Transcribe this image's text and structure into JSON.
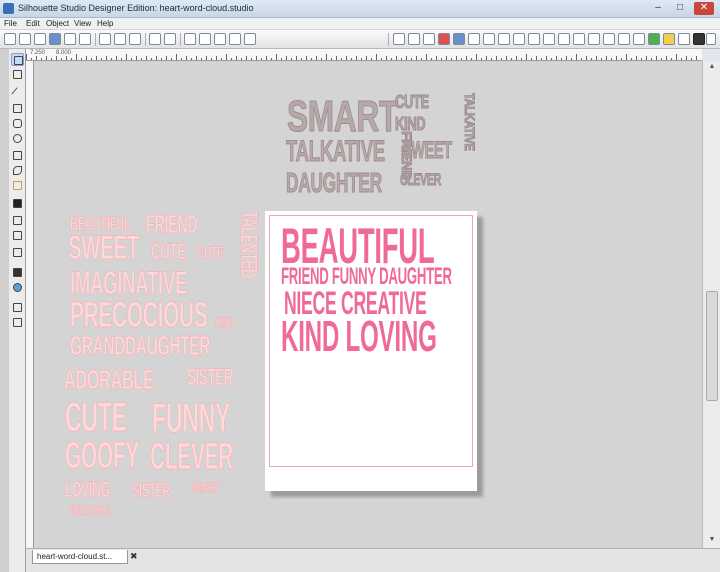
{
  "window": {
    "title": "Silhouette Studio Designer Edition: heart-word-cloud.studio",
    "minimize": "–",
    "maximize": "□",
    "close": "✕"
  },
  "menu": [
    "File",
    "Edit",
    "Object",
    "View",
    "Help"
  ],
  "ruler": {
    "labels": [
      "7.250",
      "8.000"
    ]
  },
  "colors": {
    "hot_pink": "#f06a98",
    "light_pink": "#ffd9d9",
    "grey_words": "#b8a8aa"
  },
  "grey_cloud": [
    "SMART",
    "CUTE",
    "KIND",
    "FRIEND",
    "TALKATIVE",
    "TALKATIVE",
    "SWEET",
    "DAUGHTER",
    "CLEVER"
  ],
  "pink_cloud": [
    "BEAUTIFUL",
    "FRIEND",
    "SWEET",
    "CUTE",
    "CUTE",
    "TALENTED",
    "IMAGINATIVE",
    "PRECOCIOUS",
    "KIND",
    "GRANDDAUGHTER",
    "ADORABLE",
    "SISTER",
    "CUTE",
    "FUNNY",
    "GOOFY",
    "CLEVER",
    "LOVING",
    "SISTER",
    "SMART",
    "BEAUTIFUL"
  ],
  "page_words": [
    "BEAUTIFUL",
    "FRIEND FUNNY DAUGHTER",
    "NIECE CREATIVE",
    "KIND LOVING"
  ],
  "tab": {
    "label": "heart-word-cloud.st...",
    "close": "✖"
  }
}
